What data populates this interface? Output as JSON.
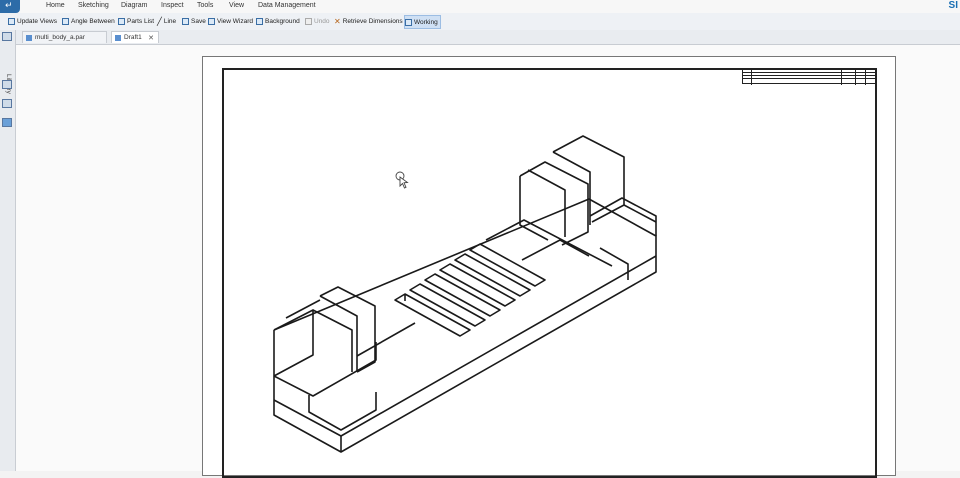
{
  "app": {
    "brand": "SI",
    "menu_glyph": "↵"
  },
  "ribbon_tabs": [
    "Home",
    "Sketching",
    "Diagram",
    "Inspect",
    "Tools",
    "View",
    "Data Management"
  ],
  "toolbar": {
    "update_views": "Update Views",
    "angle_between": "Angle Between",
    "parts_list": "Parts List",
    "line": "Line",
    "save": "Save",
    "view_wizard": "View Wizard",
    "background": "Background",
    "undo": "Undo",
    "retrieve_dimensions": "Retrieve Dimensions",
    "working": "Working"
  },
  "doc_tabs": [
    {
      "label": "multi_body_a.par",
      "active": false
    },
    {
      "label": "Draft1",
      "active": true
    }
  ],
  "library": {
    "label": "Library"
  },
  "colors": {
    "accent": "#2d6ca8",
    "toolbar": "#eef1f5",
    "sheet": "#ffffff",
    "lines": "#1a1a1a"
  }
}
